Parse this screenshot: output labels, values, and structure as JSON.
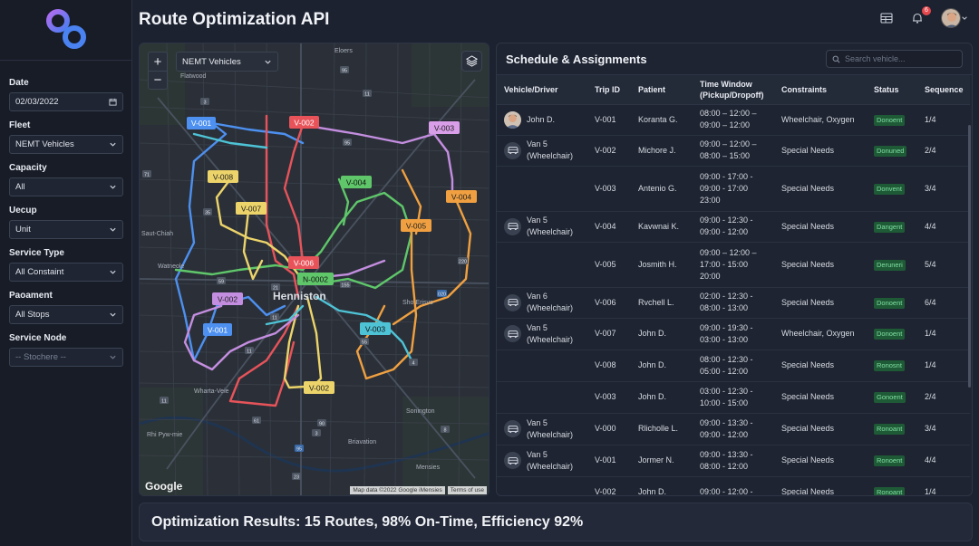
{
  "app": {
    "title": "Route Optimization API"
  },
  "header": {
    "notification_count": "6"
  },
  "sidebar": {
    "filters": [
      {
        "label": "Date",
        "value": "02/03/2022",
        "icon": "calendar-icon"
      },
      {
        "label": "Fleet",
        "value": "NEMT Vehicles",
        "icon": "chevron-down-icon"
      },
      {
        "label": "Capacity",
        "value": "All",
        "icon": "chevron-down-icon"
      },
      {
        "label": "Uecup",
        "value": "Unit",
        "icon": "chevron-down-icon"
      },
      {
        "label": "Service Type",
        "value": "All Constaint",
        "icon": "chevron-down-icon"
      },
      {
        "label": "Paoament",
        "value": "All Stops",
        "icon": "chevron-down-icon"
      },
      {
        "label": "Service Node",
        "value": "-- Stochere --",
        "icon": "chevron-down-icon"
      }
    ]
  },
  "map": {
    "zoom_in": "+",
    "zoom_out": "−",
    "fleet_select": "NEMT Vehicles",
    "city_label": "Henniston",
    "google_logo": "Google",
    "attribution": "Map data ©2022 Google  iMensies",
    "terms": "Terms of use",
    "places": [
      "Flatwood",
      "Eloers",
      "Saut-Chiah",
      "Watneole",
      "Sho Erisvo",
      "Wharta-Veie",
      "Sonington",
      "Rhi Pyw-mie",
      "Briavation",
      "Mensies"
    ],
    "route_labels": [
      "V-001",
      "V-002",
      "V-003",
      "V-008",
      "V-004",
      "V-007",
      "V-004",
      "V-005",
      "V-006",
      "N-0002",
      "V-002",
      "V-001",
      "V-003",
      "V-002"
    ],
    "highway_shields": [
      "11",
      "95",
      "95",
      "3",
      "71",
      "35",
      "59",
      "220",
      "020",
      "21",
      "11",
      "155",
      "11",
      "55",
      "4",
      "11",
      "61",
      "90",
      "3",
      "8",
      "95",
      "23"
    ]
  },
  "schedule": {
    "title": "Schedule & Assignments",
    "search_placeholder": "Search vehicle...",
    "columns": [
      "Vehicle/Driver",
      "Trip ID",
      "Patient",
      "Time Window\n(Pickup/Dropoff)",
      "Constraints",
      "Status",
      "Sequence"
    ],
    "rows": [
      {
        "vehicle": "John D.",
        "avatar": "driver-photo",
        "trip": "V-001",
        "patient": "Koranta G.",
        "time": "08:00 – 12:00 –\n09:00 – 12:00",
        "constraints": "Wheelchair, Oxygen",
        "status": "Donoent",
        "seq": "1/4"
      },
      {
        "vehicle": "Van 5\n(Wheelchair)",
        "avatar": "van-icon",
        "trip": "V-002",
        "patient": "Michore J.",
        "time": "09:00 – 12:00 –\n08:00 – 15:00",
        "constraints": "Special Needs",
        "status": "Donuned",
        "seq": "2/4"
      },
      {
        "vehicle": "",
        "avatar": "",
        "trip": "V-003",
        "patient": "Antenio G.",
        "time": "09:00 - 17:00 -\n09:00 - 17:00\n23:00",
        "constraints": "Special Needs",
        "status": "Donvent",
        "seq": "3/4"
      },
      {
        "vehicle": "Van 5\n(Wheelchair)",
        "avatar": "van-icon",
        "trip": "V-004",
        "patient": "Kavwnai K.",
        "time": "09:00 - 12:30 -\n09:00 - 12:00",
        "constraints": "Special Needs",
        "status": "Dangent",
        "seq": "4/4"
      },
      {
        "vehicle": "",
        "avatar": "",
        "trip": "V-005",
        "patient": "Josmith H.",
        "time": "09:00 – 12:00 –\n17:00 - 15:00\n20:00",
        "constraints": "Special Needs",
        "status": "Deruneri",
        "seq": "5/4"
      },
      {
        "vehicle": "Van 6\n(Wheelchair)",
        "avatar": "van-icon",
        "trip": "V-006",
        "patient": "Rvchell L.",
        "time": "02:00 - 12:30 -\n08:00 - 13:00",
        "constraints": "Special Needs",
        "status": "Donoent",
        "seq": "6/4"
      },
      {
        "vehicle": "Van 5\n(Wheelchair)",
        "avatar": "van-icon",
        "trip": "V-007",
        "patient": "John D.",
        "time": "09:00 - 19:30 -\n03:00 - 13:00",
        "constraints": "Wheelchair, Oxygen",
        "status": "Donoent",
        "seq": "1/4"
      },
      {
        "vehicle": "",
        "avatar": "",
        "trip": "V-008",
        "patient": "John D.",
        "time": "08:00 - 12:30 -\n05:00 - 12:00",
        "constraints": "Special Needs",
        "status": "Ronosnt",
        "seq": "1/4"
      },
      {
        "vehicle": "",
        "avatar": "",
        "trip": "V-003",
        "patient": "John D.",
        "time": "03:00 - 12:30 -\n10:00 - 15:00",
        "constraints": "Special Needs",
        "status": "Gonoent",
        "seq": "2/4"
      },
      {
        "vehicle": "Van 5\n(Wheelchair)",
        "avatar": "van-icon",
        "trip": "V-000",
        "patient": "Rlicholle L.",
        "time": "09:00 - 13:30 -\n09:00 - 12:00",
        "constraints": "Special Needs",
        "status": "Ronoant",
        "seq": "3/4"
      },
      {
        "vehicle": "Van 5\n(Wheelchair)",
        "avatar": "van-icon",
        "trip": "V-001",
        "patient": "Jormer N.",
        "time": "09:00 - 13:30 -\n08:00 - 12:00",
        "constraints": "Special Needs",
        "status": "Ronoent",
        "seq": "4/4"
      },
      {
        "vehicle": "",
        "avatar": "",
        "trip": "V-002",
        "patient": "John D.",
        "time": "09:00 - 12:00 -",
        "constraints": "Special Needs",
        "status": "Ronoant",
        "seq": "1/4"
      }
    ]
  },
  "results": {
    "text": "Optimization Results: 15 Routes, 98% On-Time, Efficiency 92%"
  },
  "colors": {
    "background": "#1c2230",
    "route_blue": "#4d90f0",
    "route_red": "#e8535a",
    "route_green": "#5fc76a",
    "route_yellow": "#ecd46a",
    "route_orange": "#f0a040",
    "route_purple": "#c48ee0",
    "route_cyan": "#4ec3d6",
    "status_green": "#1f5a37"
  }
}
